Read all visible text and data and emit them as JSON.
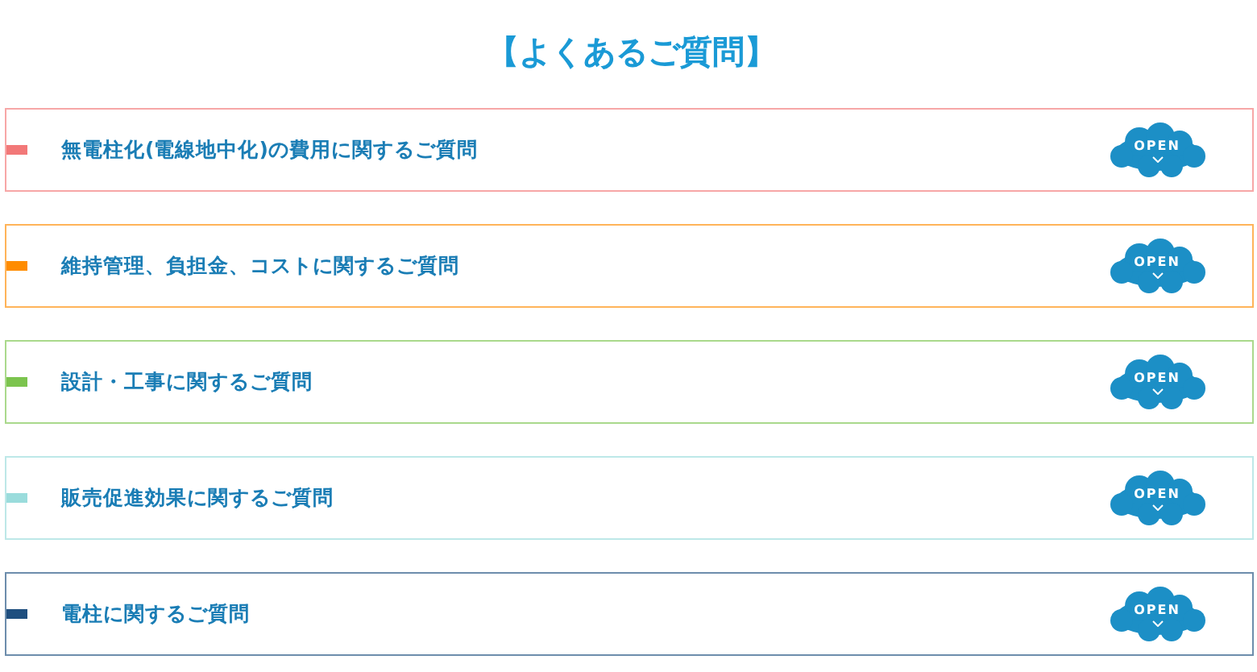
{
  "title": "【よくあるご質問】",
  "faq_categories": [
    {
      "label": "無電柱化(電線地中化)の費用に関するご質問",
      "color": "#f27878",
      "button": "OPEN"
    },
    {
      "label": "維持管理、負担金、コストに関するご質問",
      "color": "#ff8c00",
      "button": "OPEN"
    },
    {
      "label": "設計・工事に関するご質問",
      "color": "#7cc44e",
      "button": "OPEN"
    },
    {
      "label": "販売促進効果に関するご質問",
      "color": "#9adcdc",
      "button": "OPEN"
    },
    {
      "label": "電柱に関するご質問",
      "color": "#1f4f7f",
      "button": "OPEN"
    }
  ]
}
